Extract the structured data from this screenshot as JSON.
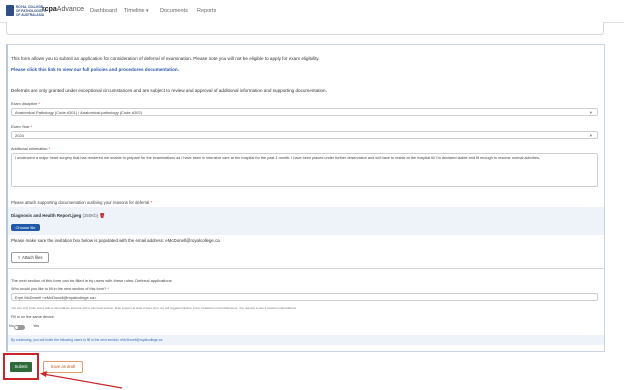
{
  "header": {
    "logo_text": "ROYAL COLLEGE\nOF PATHOLOGISTS\nOF AUSTRALASIA",
    "brand_bold": "rcpa",
    "brand_rest": "Advance",
    "nav": [
      "Dashboard",
      "Timeline",
      "Documents",
      "Reports"
    ]
  },
  "intro": {
    "line1": "This form allows you to submit an application for consideration of deferral of examination. Please note you will not be eligible to apply for exam eligibility.",
    "line2": "Please click this link to view our full policies and procedures documentation.",
    "line3": "Deferrals are only granted under exceptional circumstances and are subject to review and approval of additional information and supporting documentation."
  },
  "fields": {
    "discipline_label": "Exam discipline",
    "discipline_value": "Anatomical Pathology (Code #301) / Anatomical-pathology (Code #202)",
    "year_label": "Exam Year",
    "year_value": "2024",
    "info_label": "Additional information",
    "info_value": "I underwent a major heart surgery that has rendered me unable to prepare for the examinations as I have been in intensive care at the hospital for the past 1 month. I have been placed under further observation and will have to reside at the hospital till I'm declared stable and fit enough to resume normal activities."
  },
  "attach": {
    "prompt": "Please attach supporting documentation outlining your reasons for deferral",
    "file_name": "Diagnosis and Health Report.jpeg",
    "file_size": "(350Kb)",
    "choose_label": "Choose file",
    "invite_note": "Please make sure the invitation box below is populated with the email address: eMcDonell@royalcollege.ca",
    "attach_label": "Attach files"
  },
  "next_section": {
    "intro": "The next section of this form can be filled in by users with these roles: Deferral applications",
    "who_label": "Who would you like to fill in the next section of this form?",
    "who_value": "Eryn McDonell <eMcDonell@royalcollege.ca>",
    "help_text": "You can only invite users with a role balance account with a role level section. Rule support at least 2 days prior, we will suggest inactive. Form Invitations in the Reference: You request a user's newest email address.",
    "same_device_label": "Fill in on the same device",
    "toggle_no": "No",
    "toggle_yes": "Yes",
    "info_text": "By continuing, you will invite the following users to fill in the next section: eMcDonell@royalcollege.ca"
  },
  "actions": {
    "submit": "Submit",
    "save_draft": "Save as draft"
  },
  "colors": {
    "primary": "#1e5aa8",
    "submit": "#2f6b3a",
    "highlight": "#c9262a",
    "draft": "#d05a1e"
  }
}
